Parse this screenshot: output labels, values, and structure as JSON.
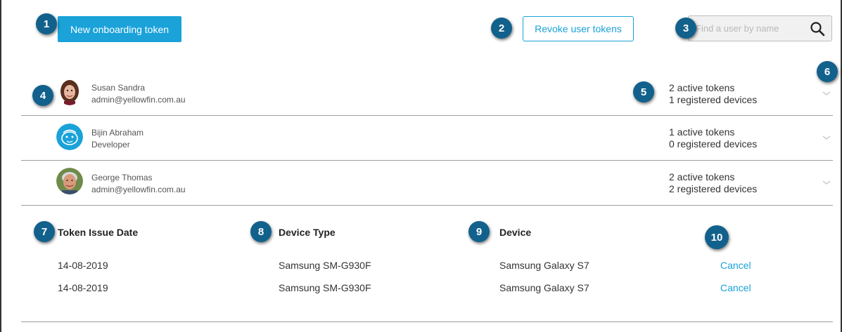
{
  "toolbar": {
    "new_token_label": "New onboarding token",
    "revoke_label": "Revoke user tokens",
    "search_placeholder": "Find a user by name"
  },
  "callouts": [
    "1",
    "2",
    "3",
    "4",
    "5",
    "6",
    "7",
    "8",
    "9",
    "10"
  ],
  "users": [
    {
      "name": "Susan Sandra",
      "sub": "admin@yellowfin.com.au",
      "tokens": "2 active tokens",
      "devices": "1 registered devices"
    },
    {
      "name": "Bijin Abraham",
      "sub": "Developer",
      "tokens": "1 active tokens",
      "devices": "0 registered devices"
    },
    {
      "name": "George Thomas",
      "sub": "admin@yellowfin.com.au",
      "tokens": "2 active tokens",
      "devices": "2 registered devices"
    }
  ],
  "token_table": {
    "headers": [
      "Token Issue Date",
      "Device Type",
      "Device"
    ],
    "rows": [
      {
        "date": "14-08-2019",
        "device_type": "Samsung SM-G930F",
        "device": "Samsung Galaxy S7",
        "action": "Cancel"
      },
      {
        "date": "14-08-2019",
        "device_type": "Samsung SM-G930F",
        "device": "Samsung Galaxy S7",
        "action": "Cancel"
      }
    ]
  },
  "colors": {
    "accent": "#1aa2d9",
    "callout": "#12618c",
    "divider": "#9e9e9e"
  },
  "icons": {
    "search": "search-icon",
    "expand": "chevron-down-icon"
  }
}
